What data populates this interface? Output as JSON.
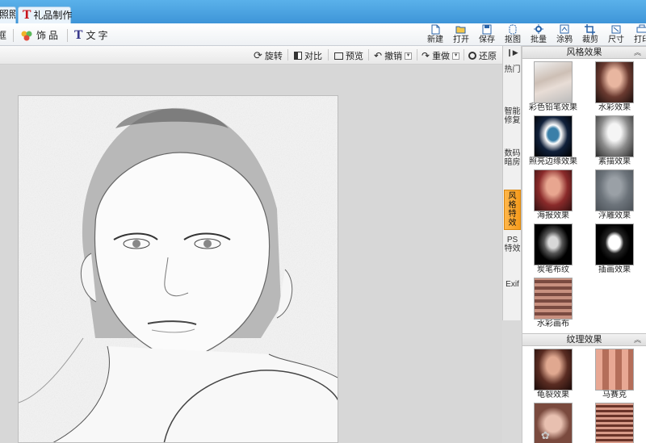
{
  "tabs": [
    {
      "label": "照照"
    },
    {
      "icon": "T",
      "label": "礼品制作"
    }
  ],
  "toolbar": {
    "left": [
      {
        "icon": "frame-icon",
        "label": "框"
      },
      {
        "icon": "flower-icon",
        "label": "饰品"
      },
      {
        "icon": "text-icon",
        "label": "文字"
      }
    ],
    "buttons": [
      {
        "label": "新建",
        "icon": "new-file-icon"
      },
      {
        "label": "打开",
        "icon": "folder-open-icon"
      },
      {
        "label": "保存",
        "icon": "save-icon"
      },
      {
        "label": "抠图",
        "icon": "cutout-icon"
      },
      {
        "label": "批量",
        "icon": "batch-icon"
      },
      {
        "label": "涂鸦",
        "icon": "doodle-icon"
      },
      {
        "label": "裁剪",
        "icon": "crop-icon"
      },
      {
        "label": "尺寸",
        "icon": "resize-icon"
      },
      {
        "label": "打印",
        "icon": "print-icon"
      }
    ]
  },
  "edit_bar": {
    "rotate": "旋转",
    "contrast": "对比",
    "preview": "预览",
    "undo": "撤销",
    "redo": "重做",
    "restore": "还原"
  },
  "side_tabs": [
    {
      "label": "热门"
    },
    {
      "label": "智能修复"
    },
    {
      "label": "数码暗房"
    },
    {
      "label": "风格特效",
      "active": true
    },
    {
      "label": "PS特效"
    },
    {
      "label": "Exif"
    }
  ],
  "panel": {
    "section1": {
      "title": "风格效果",
      "items": [
        {
          "label": "彩色铅笔效果",
          "tone": "pencil"
        },
        {
          "label": "水彩效果",
          "tone": "warm"
        },
        {
          "label": "照亮边缘效果",
          "tone": "glow"
        },
        {
          "label": "素描效果",
          "tone": "gray"
        },
        {
          "label": "海报效果",
          "tone": "poster"
        },
        {
          "label": "浮雕效果",
          "tone": "emboss"
        },
        {
          "label": "炭笔布纹",
          "tone": "charcoal"
        },
        {
          "label": "插画效果",
          "tone": "illus"
        },
        {
          "label": "水彩画布",
          "tone": "canvas"
        }
      ]
    },
    "section2": {
      "title": "纹理效果",
      "items": [
        {
          "label": "龟裂效果",
          "tone": "crack"
        },
        {
          "label": "马赛克",
          "tone": "mosaic"
        },
        {
          "label": "",
          "tone": "dots"
        },
        {
          "label": "",
          "tone": "lines"
        }
      ]
    }
  }
}
